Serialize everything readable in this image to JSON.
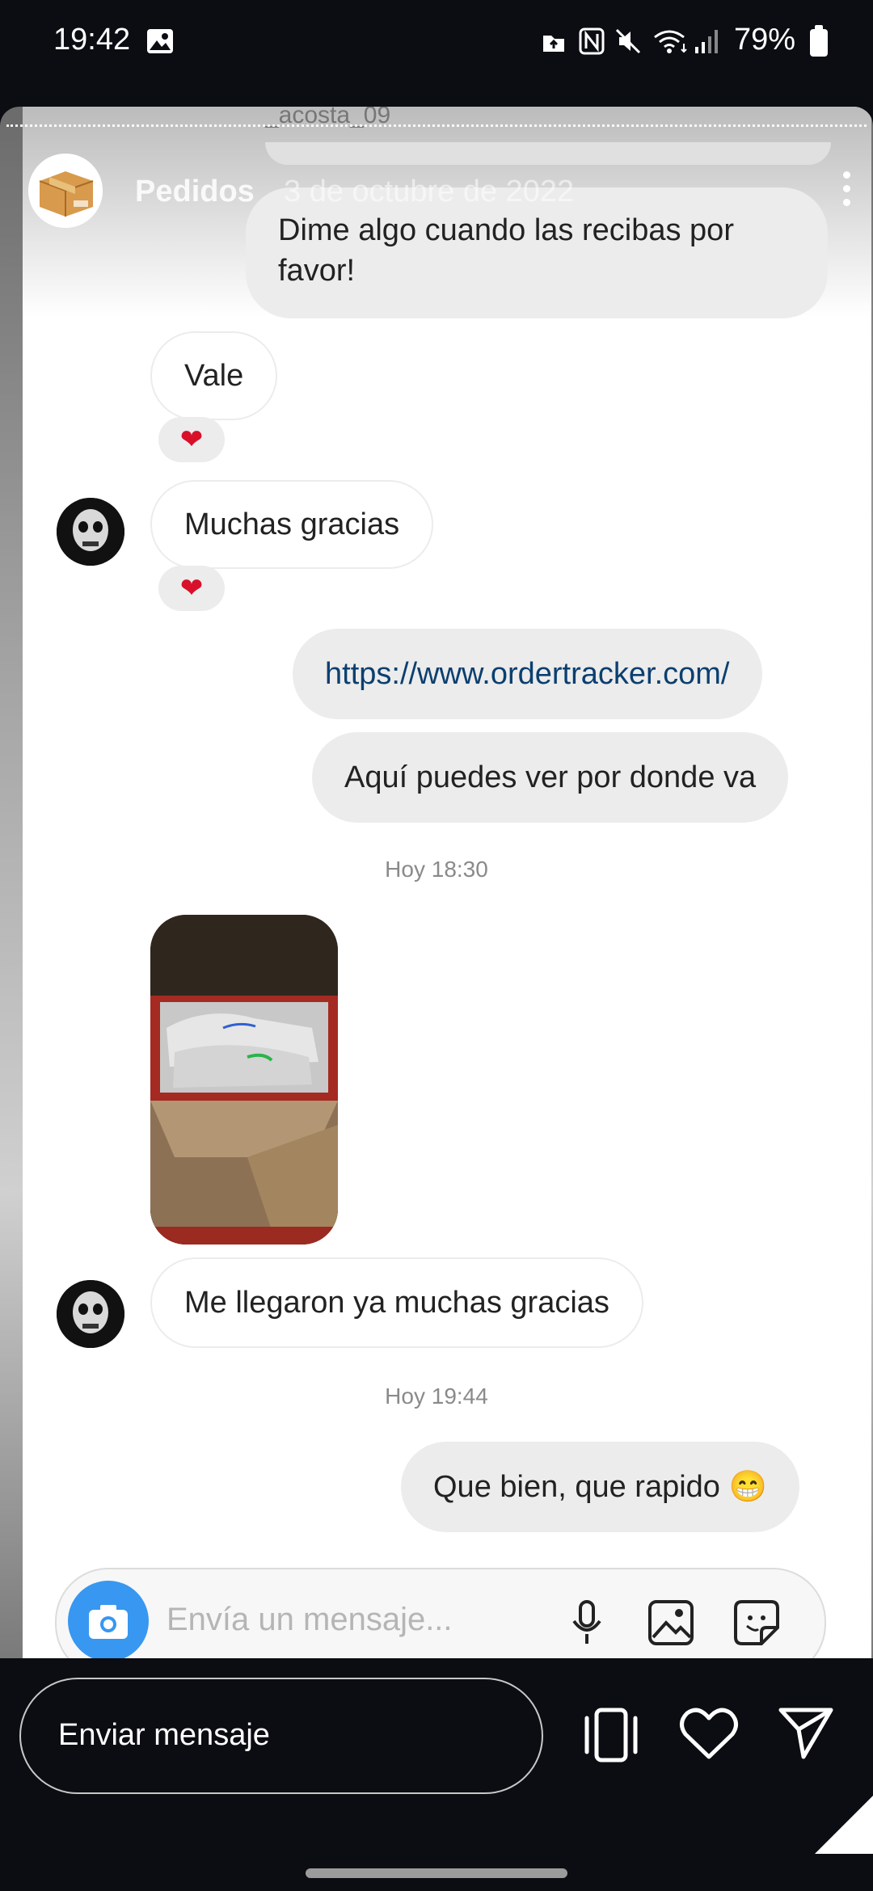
{
  "status_bar": {
    "time": "19:42",
    "battery": "79%"
  },
  "story": {
    "original_username": "_acosta_09",
    "name": "Pedidos",
    "date": "3 de octubre de 2022"
  },
  "messages": [
    {
      "dir": "out",
      "text": "Dime algo cuando las recibas por favor!"
    },
    {
      "dir": "in",
      "text": "Vale",
      "reaction": "heart"
    },
    {
      "dir": "in",
      "text": "Muchas gracias",
      "reaction": "heart"
    },
    {
      "dir": "out",
      "text": "https://www.ordertracker.com/"
    },
    {
      "dir": "out",
      "text": "Aquí puedes ver por donde va"
    }
  ],
  "timestamp_1": "Hoy 18:30",
  "photo_message": {
    "type": "image",
    "description": "shoes in box"
  },
  "messages_2": [
    {
      "dir": "in",
      "text": "Me llegaron ya muchas gracias"
    }
  ],
  "timestamp_2": "Hoy 19:44",
  "messages_3": [
    {
      "dir": "out",
      "text": "Que bien, que rapido 😁"
    }
  ],
  "composer": {
    "placeholder": "Envía un mensaje..."
  },
  "bottom_bar": {
    "reply_placeholder": "Enviar mensaje"
  },
  "colors": {
    "camera_button": "#3897f0",
    "reaction_heart": "#d8102a",
    "link": "#0b3f70"
  },
  "icons": [
    "gallery-icon",
    "cloud-icon",
    "nfc-icon",
    "mute-icon",
    "wifi-icon",
    "signal-icon",
    "camera-icon",
    "mic-icon",
    "image-icon",
    "sticker-icon",
    "multi-device-icon",
    "heart-icon",
    "send-icon"
  ]
}
